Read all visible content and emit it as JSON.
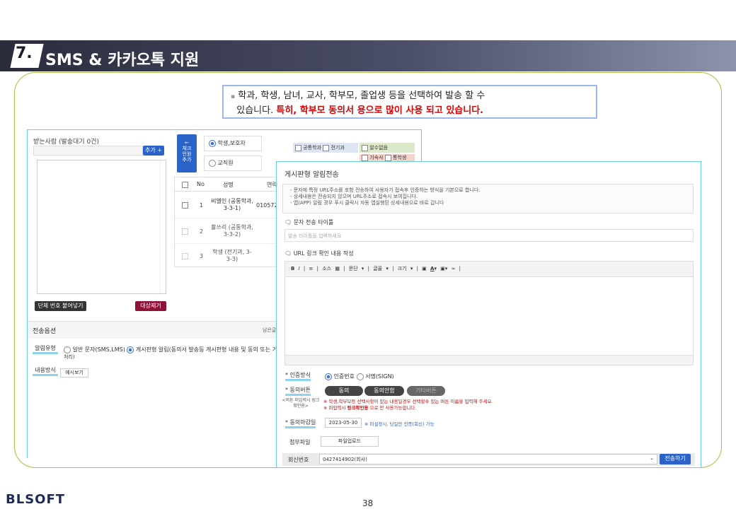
{
  "section": {
    "number": "7.",
    "title": "SMS & 카카오톡 지원"
  },
  "note": {
    "line1": "학과, 학생, 남녀, 교사, 학부모, 졸업생 등을 선택하여 발송 할 수",
    "line2_plain": "있습니다. ",
    "line2_highlight": "특히, 학부모 동의서 용으로 많이 사용 되고 있습니다."
  },
  "recipients": {
    "label": "받는사람 (발송대기 0건)",
    "add_button": "추가 +",
    "bulk_button": "단체 번호 붙여넣기",
    "remove_button": "대상제거"
  },
  "check_add": {
    "arrow": "←",
    "label": "체크\n인원\n추가"
  },
  "target_options": {
    "student_parent": "학생,보호자",
    "staff": "교직원"
  },
  "filters": [
    "공통학과",
    "전기과",
    "알수없음",
    "기숙사",
    "통학생"
  ],
  "table": {
    "headers": [
      "No",
      "성명",
      "연락"
    ],
    "rows": [
      {
        "no": "1",
        "name": "비엘인 (공통학과, 3-3-1)",
        "phone": "010572"
      },
      {
        "no": "2",
        "name": "촬쓰리 (공통학과, 3-3-2)",
        "phone": ""
      },
      {
        "no": "3",
        "name": "학생 (전기과, 3-3-3)",
        "phone": ""
      }
    ]
  },
  "send_options": {
    "title": "전송옵션",
    "remaining": "남은글",
    "type_label": "알림유형",
    "type_sms": "일반 문자(SMS,LMS)",
    "type_board": "게시판형 알림(동의서 발송등 게시판형 내용 및 동의 또는 거",
    "type_board_tail": "처리)",
    "content_label": "내용방식",
    "preview_button": "예시보기"
  },
  "modal": {
    "title": "게시판형 알림전송",
    "info": [
      "- 문자에 특정 URL주소를 포함 전송하여 사용자가 접속후 인증하는 방식을 기본으로 합니다.",
      "- 상세내용은 전송되지 않으며 URL주소로 접속시 보여집니다.",
      "- 앱(APP) 알림 경우 푸시 클릭시 자동 앱실행된 상세내용으로 바로 갑니다"
    ],
    "title_label": "문자 전송 타이틀",
    "title_placeholder": "발송 타이틀을 입력하세요",
    "content_label": "URL 링크 확인 내용 작성",
    "toolbar": [
      "B",
      "I",
      "|",
      "≡",
      "|",
      "소스",
      "▦",
      "|",
      "문단",
      "▾",
      "|",
      "글꼴",
      "▾",
      "|",
      "크기",
      "▾",
      "|",
      "▣",
      "A",
      "▾",
      "▣",
      "▾",
      "∞",
      "|"
    ],
    "auth_label": "* 인증방식",
    "auth_code": "인증번호",
    "auth_sign": "서명(SIGN)",
    "agree_label": "* 동의버튼",
    "agree_sub": "<버튼 미입력시 링크확인용>",
    "agree_btn1": "동의",
    "agree_btn2": "동의안함",
    "agree_btn3": "기타버튼",
    "agree_note1": "※ 학생,학부모등 선택사항이 있는 내용일경우 선택할수 있는 버튼 이름을 입력해 주세요",
    "agree_note2_a": "※ 미입력시 ",
    "agree_note2_b": "링크확인용",
    "agree_note2_c": " 으로 만 사용가능합니다.",
    "deadline_label": "* 동의마감일",
    "deadline_value": "2023-05-30",
    "deadline_note": "※ 미설정시, 당일만 인증(회신) 가능",
    "file_label": "첨부파일",
    "file_button": "파일업로드",
    "reply_label": "회신번호",
    "reply_value": "0427414902(회사)",
    "send_button": "전송하기"
  },
  "footer": {
    "logo": "BLSOFT",
    "page": "38"
  },
  "colors": {
    "accent": "#2b63c9",
    "frame": "#a9c23a",
    "panel": "#6ad0dd",
    "highlight": "#e00000",
    "remove": "#8e1237"
  }
}
